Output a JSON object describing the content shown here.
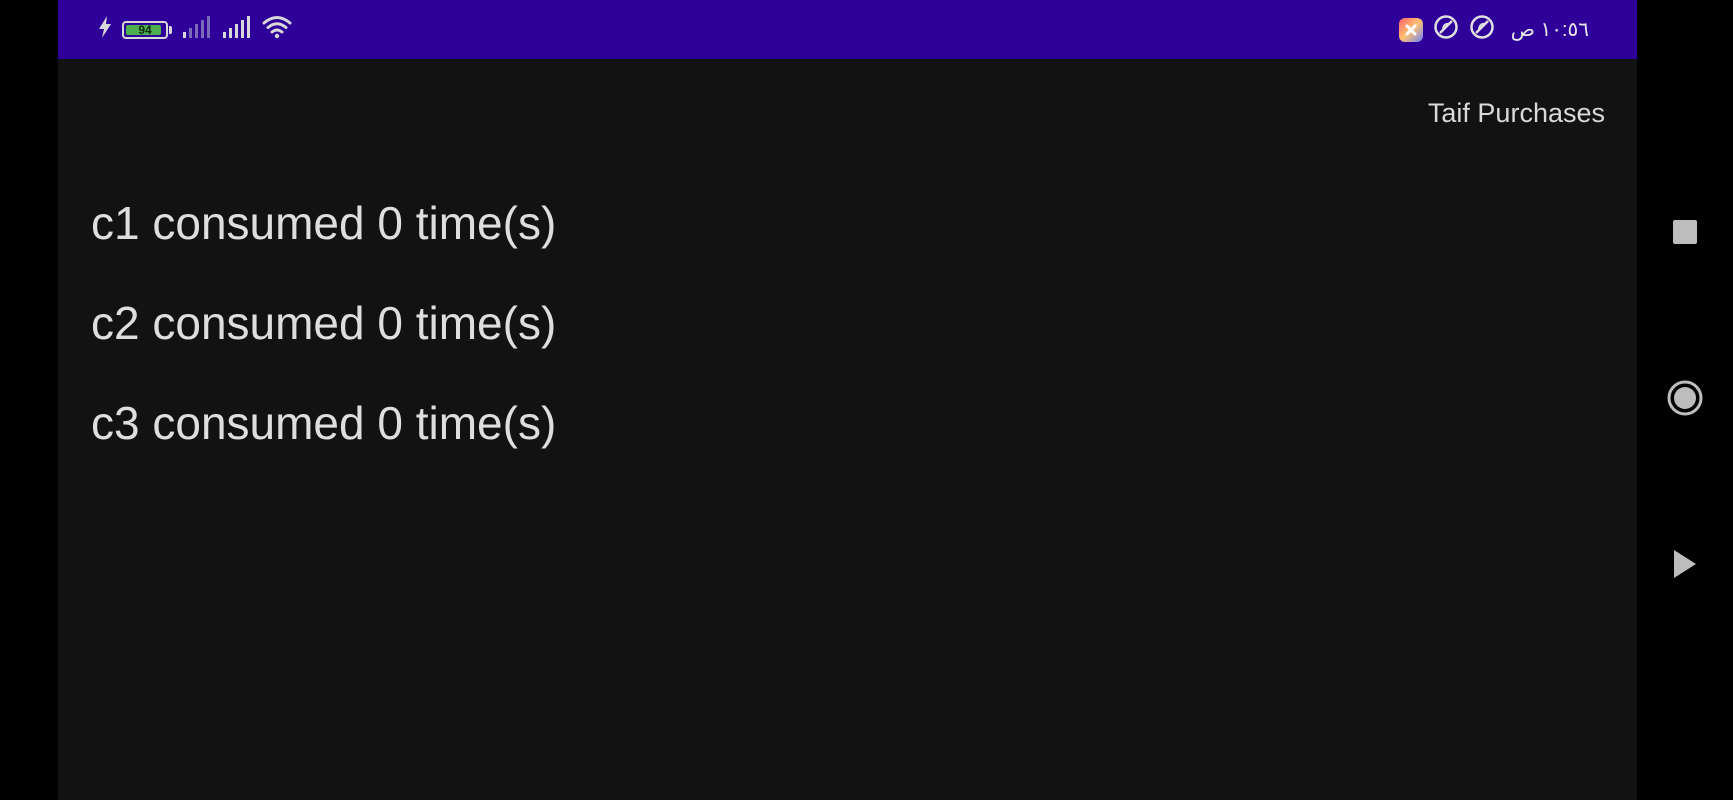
{
  "status_bar": {
    "time": "١٠:٥٦ ص",
    "battery_level": "94",
    "battery_fraction": 0.94,
    "background_color": "#2e0099",
    "icons_right": [
      "app-notification-icon",
      "restricted-icon",
      "restricted-icon"
    ],
    "icons_left": [
      "charging-bolt-icon",
      "battery-icon",
      "signal-weak-icon",
      "signal-full-icon",
      "wifi-icon"
    ]
  },
  "toolbar": {
    "title": "Taif Purchases"
  },
  "items": [
    {
      "label": "c1 consumed 0 time(s)"
    },
    {
      "label": "c2 consumed 0 time(s)"
    },
    {
      "label": "c3 consumed 0 time(s)"
    }
  ],
  "nav_bar": {
    "buttons": [
      "recents-square-icon",
      "home-circle-icon",
      "back-triangle-icon"
    ]
  },
  "colors": {
    "screen_background": "#121212",
    "text_primary": "#dedede"
  }
}
